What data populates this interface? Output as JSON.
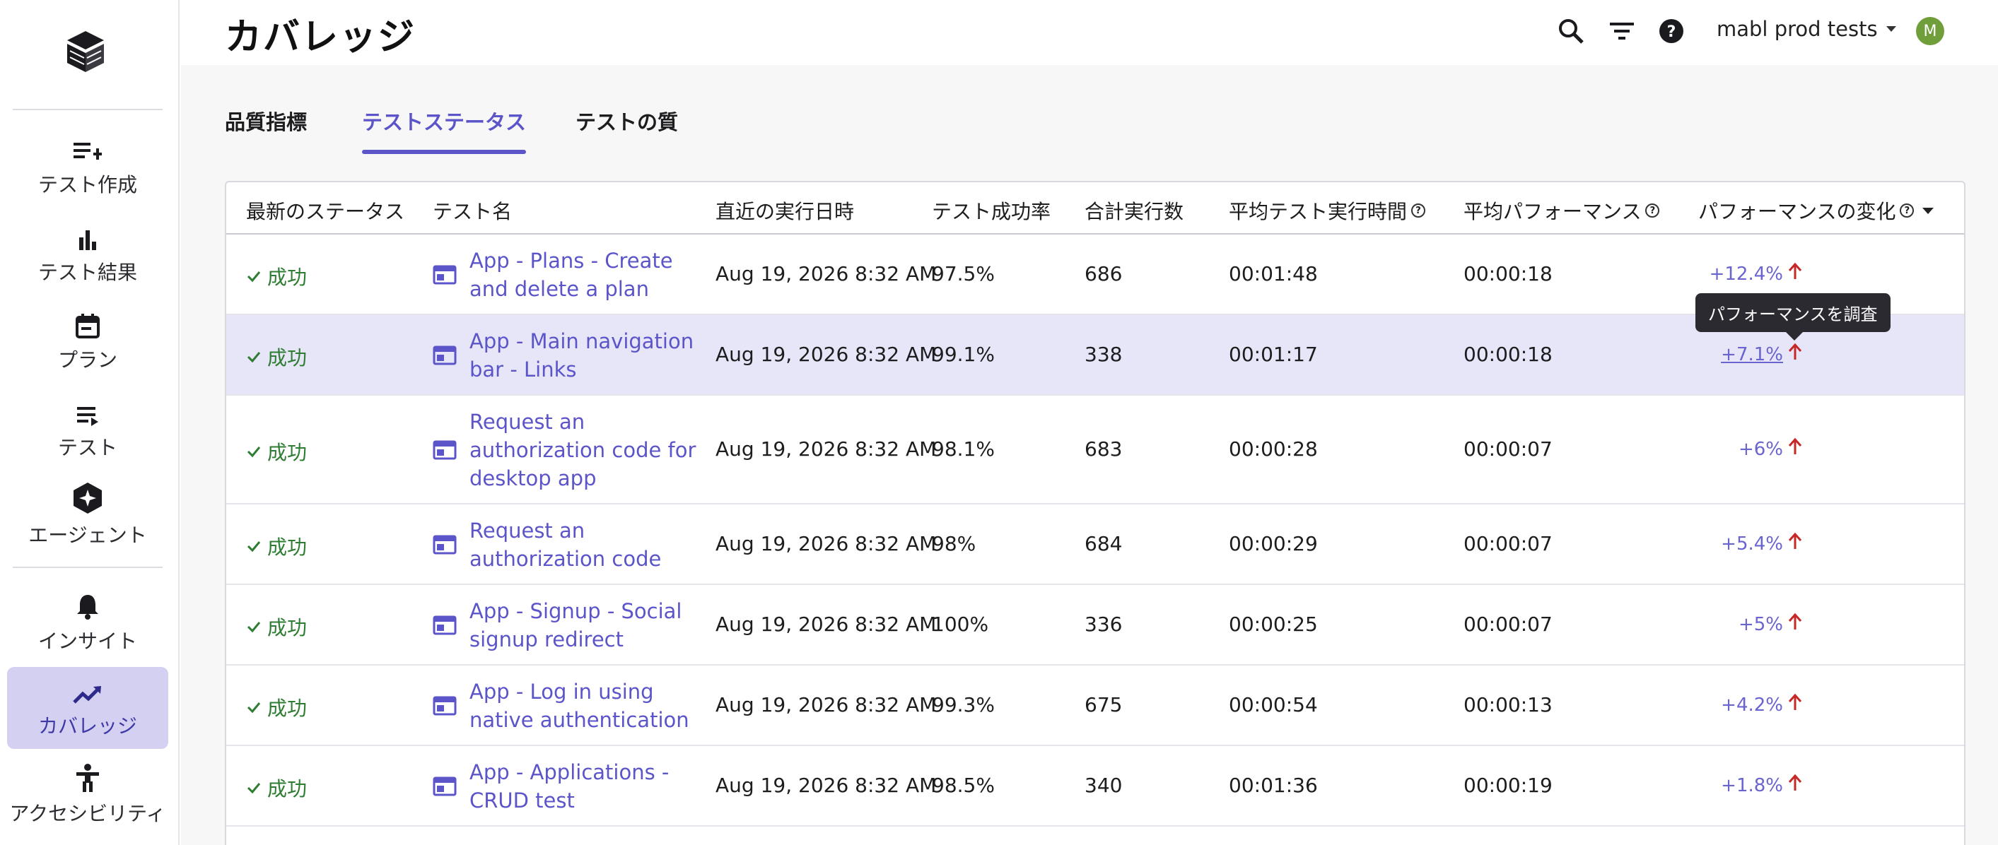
{
  "page": {
    "title": "カバレッジ"
  },
  "header": {
    "workspace": "mabl prod tests",
    "avatar_initial": "M",
    "icons": [
      "search-icon",
      "filter-icon",
      "help-icon"
    ]
  },
  "sidebar": {
    "items": [
      {
        "label": "テスト作成",
        "icon": "add-list-icon"
      },
      {
        "label": "テスト結果",
        "icon": "bar-chart-icon"
      },
      {
        "label": "プラン",
        "icon": "calendar-icon"
      },
      {
        "label": "テスト",
        "icon": "list-icon"
      },
      {
        "label": "エージェント",
        "icon": "agent-sparkle-icon"
      },
      {
        "label": "インサイト",
        "icon": "bell-icon"
      },
      {
        "label": "カバレッジ",
        "icon": "trending-up-icon",
        "active": true
      },
      {
        "label": "アクセシビリティ",
        "icon": "accessibility-icon"
      }
    ]
  },
  "tabs": [
    {
      "label": "品質指標"
    },
    {
      "label": "テストステータス",
      "active": true
    },
    {
      "label": "テストの質"
    }
  ],
  "table": {
    "columns": [
      "最新のステータス",
      "テスト名",
      "直近の実行日時",
      "テスト成功率",
      "合計実行数",
      "平均テスト実行時間",
      "平均パフォーマンス",
      "パフォーマンスの変化"
    ],
    "rows": [
      {
        "status": "成功",
        "name": "App - Plans - Create and delete a plan",
        "date": "Aug 19, 2026 8:32 AM",
        "rate": "97.5%",
        "runs": "686",
        "avg_time": "00:01:48",
        "avg_perf": "00:00:18",
        "change": "+12.4%"
      },
      {
        "status": "成功",
        "name": "App - Main navigation bar - Links",
        "date": "Aug 19, 2026 8:32 AM",
        "rate": "99.1%",
        "runs": "338",
        "avg_time": "00:01:17",
        "avg_perf": "00:00:18",
        "change": "+7.1%"
      },
      {
        "status": "成功",
        "name": "Request an authorization code for desktop app",
        "date": "Aug 19, 2026 8:32 AM",
        "rate": "98.1%",
        "runs": "683",
        "avg_time": "00:00:28",
        "avg_perf": "00:00:07",
        "change": "+6%"
      },
      {
        "status": "成功",
        "name": "Request an authorization code",
        "date": "Aug 19, 2026 8:32 AM",
        "rate": "98%",
        "runs": "684",
        "avg_time": "00:00:29",
        "avg_perf": "00:00:07",
        "change": "+5.4%"
      },
      {
        "status": "成功",
        "name": "App - Signup - Social signup redirect",
        "date": "Aug 19, 2026 8:32 AM",
        "rate": "100%",
        "runs": "336",
        "avg_time": "00:00:25",
        "avg_perf": "00:00:07",
        "change": "+5%"
      },
      {
        "status": "成功",
        "name": "App - Log in using native authentication",
        "date": "Aug 19, 2026 8:32 AM",
        "rate": "99.3%",
        "runs": "675",
        "avg_time": "00:00:54",
        "avg_perf": "00:00:13",
        "change": "+4.2%"
      },
      {
        "status": "成功",
        "name": "App - Applications - CRUD test",
        "date": "Aug 19, 2026 8:32 AM",
        "rate": "98.5%",
        "runs": "340",
        "avg_time": "00:01:36",
        "avg_perf": "00:00:19",
        "change": "+1.8%"
      }
    ]
  },
  "tooltip": "パフォーマンスを調査",
  "colors": {
    "accent": "#5b55c9",
    "success": "#2e7d32",
    "increase": "#c62828",
    "active_nav": "#d3d0f1",
    "highlight_row": "#e7e6f8"
  }
}
